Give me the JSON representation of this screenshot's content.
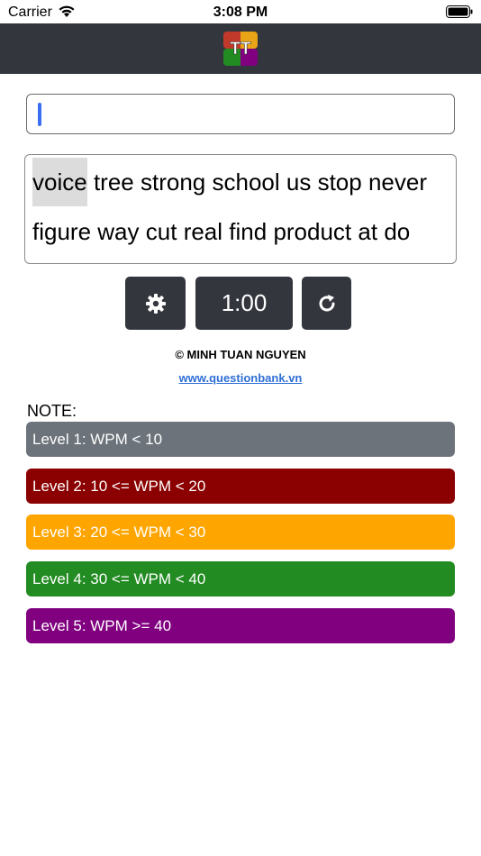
{
  "status_bar": {
    "carrier": "Carrier",
    "time": "3:08 PM"
  },
  "header": {
    "logo_text": "TT",
    "logo_colors": [
      "#c0392b",
      "#e8a317",
      "#228b22",
      "#800080"
    ]
  },
  "typing_input": {
    "value": ""
  },
  "words": {
    "line1": [
      "voice",
      "tree",
      "strong",
      "school",
      "us",
      "stop",
      "never"
    ],
    "line2": [
      "figure",
      "way",
      "cut",
      "real",
      "find",
      "product",
      "at",
      "do"
    ],
    "current_word": "voice"
  },
  "controls": {
    "settings_icon": "gear-icon",
    "timer": "1:00",
    "reset_icon": "refresh-icon"
  },
  "footer": {
    "copyright": "© MINH TUAN NGUYEN",
    "website": "www.questionbank.vn"
  },
  "note": {
    "label": "NOTE:",
    "levels": [
      {
        "label": "Level 1: WPM < 10",
        "color": "#6c737a"
      },
      {
        "label": "Level 2: 10 <= WPM < 20",
        "color": "#8b0000"
      },
      {
        "label": "Level 3: 20 <= WPM < 30",
        "color": "#ffa500"
      },
      {
        "label": "Level 4: 30 <= WPM < 40",
        "color": "#228b22"
      },
      {
        "label": "Level 5: WPM >= 40",
        "color": "#800080"
      }
    ]
  }
}
